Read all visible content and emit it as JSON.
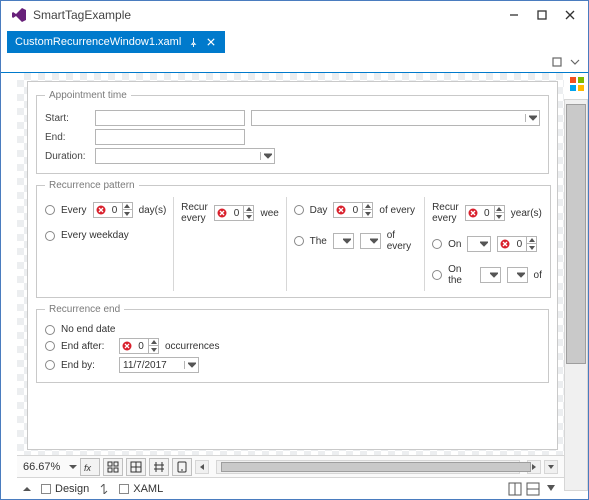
{
  "window": {
    "title": "SmartTagExample"
  },
  "tab": {
    "label": "CustomRecurrenceWindow1.xaml"
  },
  "form": {
    "appt": {
      "legend": "Appointment time",
      "start": "Start:",
      "end": "End:",
      "duration": "Duration:"
    },
    "pattern": {
      "legend": "Recurrence pattern",
      "every": "Every",
      "days": "day(s)",
      "every_weekday": "Every weekday",
      "recur_every1": "Recur every",
      "wee": "wee",
      "day": "Day",
      "of_every1": "of every",
      "the": "The",
      "of_every2": "of every",
      "recur_every2": "Recur every",
      "years": "year(s)",
      "on": "On",
      "on_the": "On the",
      "of": "of",
      "num": "0"
    },
    "end": {
      "legend": "Recurrence end",
      "no_end": "No end date",
      "end_after": "End after:",
      "occurrences": "occurrences",
      "end_by": "End by:",
      "date": "11/7/2017",
      "num": "0"
    }
  },
  "status": {
    "zoom": "66.67%"
  },
  "views": {
    "design": "Design",
    "xaml": "XAML"
  }
}
